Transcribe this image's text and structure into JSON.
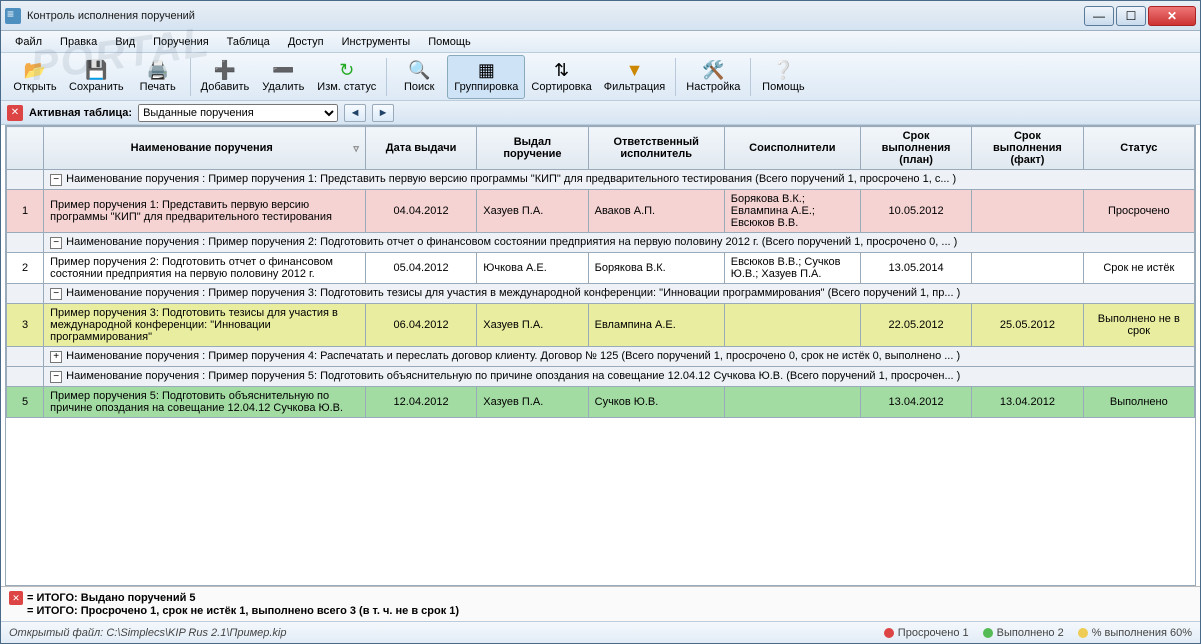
{
  "window": {
    "title": "Контроль исполнения поручений"
  },
  "menu": {
    "file": "Файл",
    "edit": "Правка",
    "view": "Вид",
    "tasks": "Поручения",
    "table": "Таблица",
    "access": "Доступ",
    "tools": "Инструменты",
    "help": "Помощь"
  },
  "toolbar": {
    "open": "Открыть",
    "save": "Сохранить",
    "print": "Печать",
    "add": "Добавить",
    "delete": "Удалить",
    "chstatus": "Изм. статус",
    "search": "Поиск",
    "group": "Группировка",
    "sort": "Сортировка",
    "filter": "Фильтрация",
    "settings": "Настройка",
    "help": "Помощь"
  },
  "subbar": {
    "label": "Активная таблица:",
    "selected": "Выданные поручения"
  },
  "columns": {
    "name": "Наименование поручения",
    "date": "Дата выдачи",
    "issuer": "Выдал поручение",
    "responsible": "Ответственный исполнитель",
    "coexec": "Соисполнители",
    "due_plan": "Срок выполнения (план)",
    "due_fact": "Срок выполнения (факт)",
    "status": "Статус"
  },
  "groups": {
    "g1": "Наименование поручения : Пример поручения 1: Представить первую версию программы \"КИП\" для предварительного тестирования (Всего поручений 1, просрочено 1, с... )",
    "g2": "Наименование поручения : Пример поручения 2: Подготовить отчет о финансовом состоянии предприятия на первую половину 2012 г. (Всего поручений 1, просрочено 0, ... )",
    "g3": "Наименование поручения : Пример поручения 3: Подготовить тезисы для участия в международной конференции: \"Инновации программирования\" (Всего поручений 1, пр... )",
    "g4": "Наименование поручения : Пример поручения 4: Распечатать и переслать договор клиенту. Договор № 125 (Всего поручений 1, просрочено 0, срок не истёк 0, выполнено ... )",
    "g5": "Наименование поручения : Пример поручения 5: Подготовить объяснительную по причине опоздания на совещание  12.04.12 Сучкова Ю.В. (Всего поручений 1, просрочен... )"
  },
  "rows": {
    "r1": {
      "num": "1",
      "name": "Пример поручения 1: Представить первую версию программы \"КИП\" для предварительного тестирования",
      "date": "04.04.2012",
      "issuer": "Хазуев П.А.",
      "resp": "Аваков А.П.",
      "co": "Борякова В.К.; Евлампина А.Е.; Евсюков В.В.",
      "plan": "10.05.2012",
      "fact": "",
      "status": "Просрочено"
    },
    "r2": {
      "num": "2",
      "name": "Пример поручения 2: Подготовить отчет о финансовом состоянии предприятия на первую половину 2012 г.",
      "date": "05.04.2012",
      "issuer": "Ючкова А.Е.",
      "resp": "Борякова В.К.",
      "co": "Евсюков В.В.; Сучков Ю.В.; Хазуев П.А.",
      "plan": "13.05.2014",
      "fact": "",
      "status": "Срок не истёк"
    },
    "r3": {
      "num": "3",
      "name": "Пример поручения 3: Подготовить тезисы для участия в международной конференции: \"Инновации программирования\"",
      "date": "06.04.2012",
      "issuer": "Хазуев П.А.",
      "resp": "Евлампина А.Е.",
      "co": "",
      "plan": "22.05.2012",
      "fact": "25.05.2012",
      "status": "Выполнено не в срок"
    },
    "r5": {
      "num": "5",
      "name": "Пример поручения 5: Подготовить объяснительную по причине опоздания на совещание  12.04.12 Сучкова Ю.В.",
      "date": "12.04.2012",
      "issuer": "Хазуев П.А.",
      "resp": "Сучков Ю.В.",
      "co": "",
      "plan": "13.04.2012",
      "fact": "13.04.2012",
      "status": "Выполнено"
    }
  },
  "summary": {
    "line1": "= ИТОГО: Выдано поручений 5",
    "line2": "= ИТОГО: Просрочено 1, срок не истёк 1, выполнено всего 3 (в т. ч. не в срок 1)"
  },
  "statusbar": {
    "file_label": "Открытый файл:",
    "file_path": "C:\\Simplecs\\KIP Rus 2.1\\Пример.kip",
    "overdue": "Просрочено 1",
    "done": "Выполнено 2",
    "percent": "% выполнения 60%"
  },
  "watermark": "PORTAL"
}
